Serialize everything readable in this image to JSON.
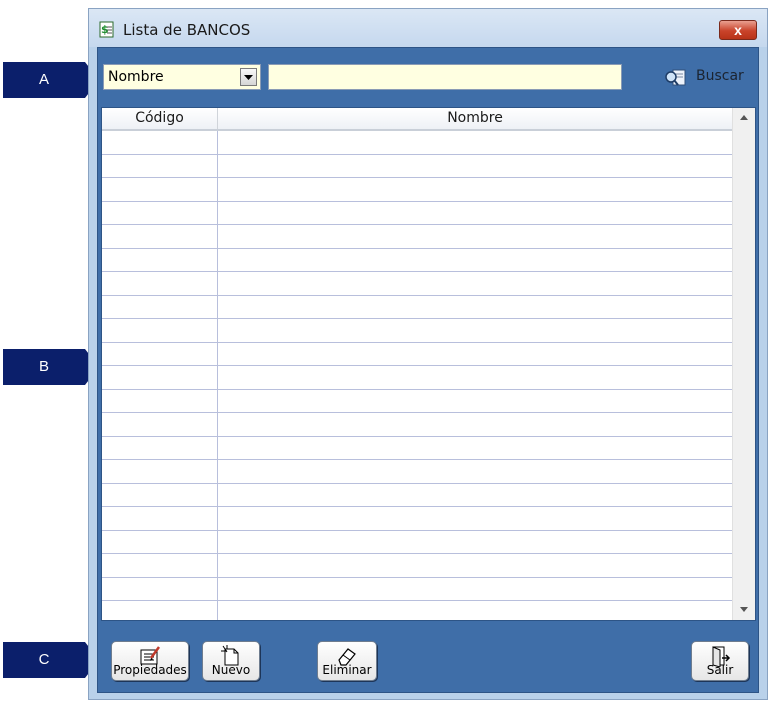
{
  "callouts": [
    "A",
    "B",
    "C"
  ],
  "window": {
    "title": "Lista de BANCOS",
    "close_label": "x"
  },
  "search": {
    "field_selected": "Nombre",
    "query_value": "",
    "search_button_label": "Buscar"
  },
  "grid": {
    "columns": [
      "Código",
      "Nombre"
    ],
    "row_count": 21
  },
  "toolbar": {
    "properties_label": "Propiedades",
    "new_label": "Nuevo",
    "delete_label": "Eliminar",
    "exit_label": "Salir"
  },
  "colors": {
    "callout": "#0b1f6b",
    "panel": "#3f6ea8",
    "input_bg": "#ffffe1"
  }
}
